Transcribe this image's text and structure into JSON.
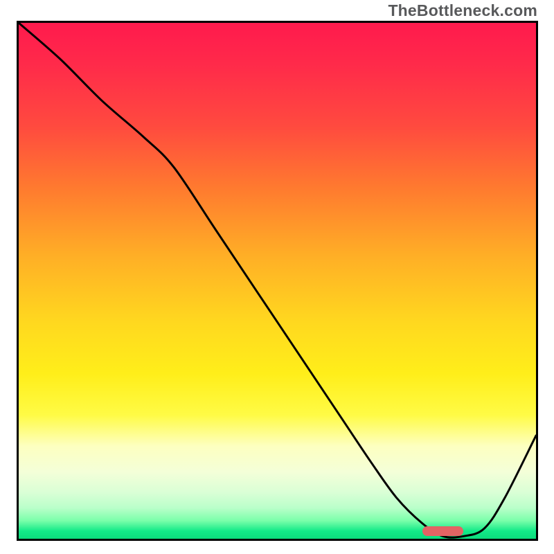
{
  "attribution": "TheBottleneck.com",
  "chart_data": {
    "type": "line",
    "title": "",
    "xlabel": "",
    "ylabel": "",
    "xlim": [
      0,
      100
    ],
    "ylim": [
      0,
      100
    ],
    "x": [
      0,
      8,
      16,
      24,
      30,
      38,
      46,
      54,
      62,
      68,
      73,
      78,
      82,
      86,
      90,
      94,
      100
    ],
    "values": [
      100,
      93,
      85,
      78,
      72,
      60,
      48,
      36,
      24,
      15,
      8,
      3,
      0.5,
      0.5,
      2,
      8,
      20
    ],
    "optimum_range_x": [
      78,
      86
    ],
    "gradient_stops": [
      {
        "pos": 0,
        "color": "#ff1a4d"
      },
      {
        "pos": 50,
        "color": "#ffd81f"
      },
      {
        "pos": 82,
        "color": "#fdffc0"
      },
      {
        "pos": 100,
        "color": "#0bdc7d"
      }
    ]
  },
  "frame": {
    "inner_w": 747,
    "inner_h": 745
  },
  "marker_style": {
    "height": 14,
    "radius": 999
  }
}
